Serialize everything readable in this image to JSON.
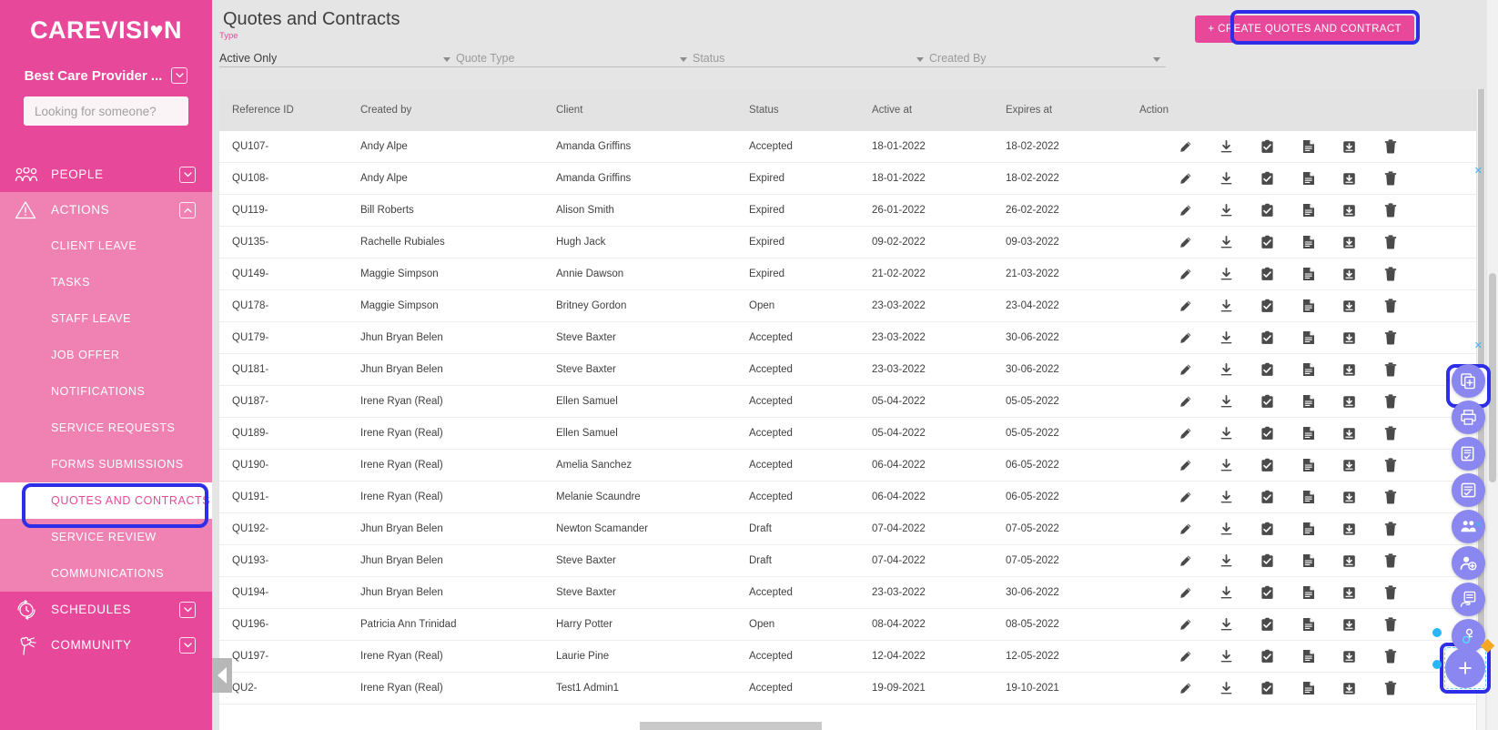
{
  "brand": {
    "name_left": "CAREVISI",
    "heart": "♥",
    "name_right": "N"
  },
  "sidebar": {
    "provider": "Best Care Provider ...",
    "search_placeholder": "Looking for someone?",
    "groups": [
      {
        "label": "PEOPLE",
        "icon": "people-icon",
        "expanded": false
      },
      {
        "label": "ACTIONS",
        "icon": "alert-triangle-icon",
        "expanded": true
      },
      {
        "label": "SCHEDULES",
        "icon": "clock-refresh-icon",
        "expanded": false
      },
      {
        "label": "COMMUNITY",
        "icon": "heart-flower-icon",
        "expanded": false
      }
    ],
    "actions_items": [
      {
        "label": "CLIENT LEAVE",
        "active": false
      },
      {
        "label": "TASKS",
        "active": false
      },
      {
        "label": "STAFF LEAVE",
        "active": false
      },
      {
        "label": "JOB OFFER",
        "active": false
      },
      {
        "label": "NOTIFICATIONS",
        "active": false
      },
      {
        "label": "SERVICE REQUESTS",
        "active": false
      },
      {
        "label": "FORMS SUBMISSIONS",
        "active": false
      },
      {
        "label": "QUOTES AND CONTRACTS",
        "active": true
      },
      {
        "label": "SERVICE REVIEW",
        "active": false
      },
      {
        "label": "COMMUNICATIONS",
        "active": false
      }
    ]
  },
  "header": {
    "title": "Quotes and Contracts",
    "create_button": "+ CREATE QUOTES AND CONTRACT"
  },
  "filters": [
    {
      "label": "Type",
      "value": "Active Only",
      "placeholder": ""
    },
    {
      "label": "",
      "value": "",
      "placeholder": "Quote Type"
    },
    {
      "label": "",
      "value": "",
      "placeholder": "Status"
    },
    {
      "label": "",
      "value": "",
      "placeholder": "Created By"
    }
  ],
  "table": {
    "columns": [
      "Reference ID",
      "Created by",
      "Client",
      "Status",
      "Active at",
      "Expires at",
      "Action"
    ],
    "action_icons": [
      "pencil-icon",
      "download-icon",
      "clipboard-check-icon",
      "document-icon",
      "archive-in-icon",
      "trash-icon"
    ],
    "rows": [
      {
        "ref": "QU107-",
        "by": "Andy Alpe",
        "client": "Amanda Griffins",
        "status": "Accepted",
        "active_at": "18-01-2022",
        "expires_at": "18-02-2022"
      },
      {
        "ref": "QU108-",
        "by": "Andy Alpe",
        "client": "Amanda Griffins",
        "status": "Expired",
        "active_at": "18-01-2022",
        "expires_at": "18-02-2022"
      },
      {
        "ref": "QU119-",
        "by": "Bill Roberts",
        "client": "Alison Smith",
        "status": "Expired",
        "active_at": "26-01-2022",
        "expires_at": "26-02-2022"
      },
      {
        "ref": "QU135-",
        "by": "Rachelle Rubiales",
        "client": "Hugh Jack",
        "status": "Expired",
        "active_at": "09-02-2022",
        "expires_at": "09-03-2022"
      },
      {
        "ref": "QU149-",
        "by": "Maggie Simpson",
        "client": "Annie Dawson",
        "status": "Expired",
        "active_at": "21-02-2022",
        "expires_at": "21-03-2022"
      },
      {
        "ref": "QU178-",
        "by": "Maggie Simpson",
        "client": "Britney Gordon",
        "status": "Open",
        "active_at": "23-03-2022",
        "expires_at": "23-04-2022"
      },
      {
        "ref": "QU179-",
        "by": "Jhun Bryan Belen",
        "client": "Steve Baxter",
        "status": "Accepted",
        "active_at": "23-03-2022",
        "expires_at": "30-06-2022"
      },
      {
        "ref": "QU181-",
        "by": "Jhun Bryan Belen",
        "client": "Steve Baxter",
        "status": "Accepted",
        "active_at": "23-03-2022",
        "expires_at": "30-06-2022"
      },
      {
        "ref": "QU187-",
        "by": "Irene Ryan (Real)",
        "client": "Ellen Samuel",
        "status": "Accepted",
        "active_at": "05-04-2022",
        "expires_at": "05-05-2022"
      },
      {
        "ref": "QU189-",
        "by": "Irene Ryan (Real)",
        "client": "Ellen Samuel",
        "status": "Accepted",
        "active_at": "05-04-2022",
        "expires_at": "05-05-2022"
      },
      {
        "ref": "QU190-",
        "by": "Irene Ryan (Real)",
        "client": "Amelia Sanchez",
        "status": "Accepted",
        "active_at": "06-04-2022",
        "expires_at": "06-05-2022"
      },
      {
        "ref": "QU191-",
        "by": "Irene Ryan (Real)",
        "client": "Melanie Scaundre",
        "status": "Accepted",
        "active_at": "06-04-2022",
        "expires_at": "06-05-2022"
      },
      {
        "ref": "QU192-",
        "by": "Jhun Bryan Belen",
        "client": "Newton Scamander",
        "status": "Draft",
        "active_at": "07-04-2022",
        "expires_at": "07-05-2022"
      },
      {
        "ref": "QU193-",
        "by": "Jhun Bryan Belen",
        "client": "Steve Baxter",
        "status": "Draft",
        "active_at": "07-04-2022",
        "expires_at": "07-05-2022"
      },
      {
        "ref": "QU194-",
        "by": "Jhun Bryan Belen",
        "client": "Steve Baxter",
        "status": "Accepted",
        "active_at": "23-03-2022",
        "expires_at": "30-06-2022"
      },
      {
        "ref": "QU196-",
        "by": "Patricia Ann Trinidad",
        "client": "Harry Potter",
        "status": "Open",
        "active_at": "08-04-2022",
        "expires_at": "08-05-2022"
      },
      {
        "ref": "QU197-",
        "by": "Irene Ryan (Real)",
        "client": "Laurie Pine",
        "status": "Accepted",
        "active_at": "12-04-2022",
        "expires_at": "12-05-2022"
      },
      {
        "ref": "QU2-",
        "by": "Irene Ryan (Real)",
        "client": "Test1 Admin1",
        "status": "Accepted",
        "active_at": "19-09-2021",
        "expires_at": "19-10-2021"
      }
    ]
  },
  "fabs": [
    {
      "icon": "copy-add-icon",
      "highlighted": true
    },
    {
      "icon": "print-icon",
      "highlighted": false
    },
    {
      "icon": "document-copy-check-icon",
      "highlighted": false
    },
    {
      "icon": "document-check-icon",
      "highlighted": false
    },
    {
      "icon": "people-group-icon",
      "highlighted": false
    },
    {
      "icon": "person-add-icon",
      "highlighted": false
    },
    {
      "icon": "hand-document-icon",
      "highlighted": false
    },
    {
      "icon": "person-key-icon",
      "highlighted": false
    }
  ],
  "fab_main": {
    "icon": "plus-icon",
    "label": "+"
  },
  "colors": {
    "brand_pink": "#e8489a",
    "sidebar_sub_pink": "#ef82b3",
    "highlight_blue": "#2e2ee8",
    "fab_purple": "#8b87f0",
    "cyan_marker": "#29b6f6",
    "orange_marker": "#f5a623"
  }
}
